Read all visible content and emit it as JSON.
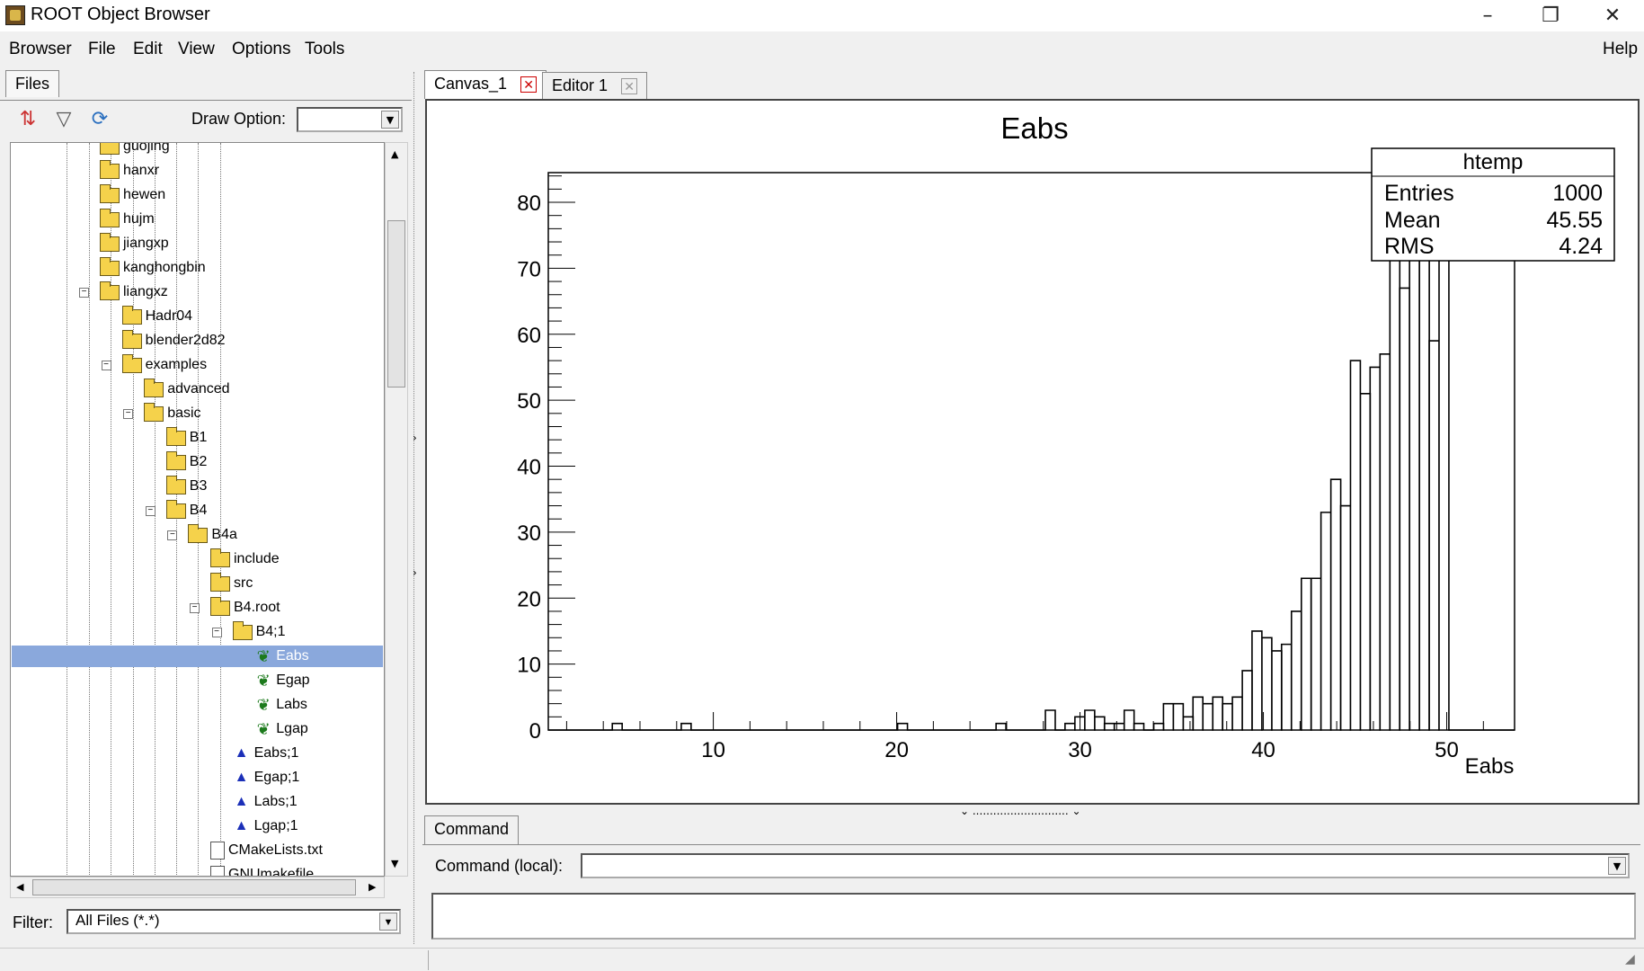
{
  "window": {
    "title": "ROOT Object Browser"
  },
  "menu": {
    "browser": "Browser",
    "file": "File",
    "edit": "Edit",
    "view": "View",
    "options": "Options",
    "tools": "Tools",
    "help": "Help"
  },
  "left": {
    "tab": "Files",
    "draw_option_label": "Draw Option:",
    "draw_option_value": "",
    "filter_label": "Filter:",
    "filter_value": "All Files (*.*)"
  },
  "tree": [
    {
      "label": "guojing",
      "icon": "folder"
    },
    {
      "label": "hanxr",
      "icon": "folder"
    },
    {
      "label": "hewen",
      "icon": "folder"
    },
    {
      "label": "hujm",
      "icon": "folder"
    },
    {
      "label": "jiangxp",
      "icon": "folder"
    },
    {
      "label": "kanghongbin",
      "icon": "folder"
    },
    {
      "label": "liangxz",
      "icon": "folder-open"
    },
    {
      "label": "Hadr04",
      "icon": "folder"
    },
    {
      "label": "blender2d82",
      "icon": "folder"
    },
    {
      "label": "examples",
      "icon": "folder-open"
    },
    {
      "label": "advanced",
      "icon": "folder"
    },
    {
      "label": "basic",
      "icon": "folder-open"
    },
    {
      "label": "B1",
      "icon": "folder"
    },
    {
      "label": "B2",
      "icon": "folder"
    },
    {
      "label": "B3",
      "icon": "folder"
    },
    {
      "label": "B4",
      "icon": "folder-open"
    },
    {
      "label": "B4a",
      "icon": "folder-open"
    },
    {
      "label": "include",
      "icon": "folder"
    },
    {
      "label": "src",
      "icon": "folder"
    },
    {
      "label": "B4.root",
      "icon": "root-file"
    },
    {
      "label": "B4;1",
      "icon": "tree"
    },
    {
      "label": "Eabs",
      "icon": "leaf",
      "selected": true
    },
    {
      "label": "Egap",
      "icon": "leaf"
    },
    {
      "label": "Labs",
      "icon": "leaf"
    },
    {
      "label": "Lgap",
      "icon": "leaf"
    },
    {
      "label": "Eabs;1",
      "icon": "histogram"
    },
    {
      "label": "Egap;1",
      "icon": "histogram"
    },
    {
      "label": "Labs;1",
      "icon": "histogram"
    },
    {
      "label": "Lgap;1",
      "icon": "histogram"
    },
    {
      "label": "CMakeLists.txt",
      "icon": "file"
    },
    {
      "label": "GNUmakefile",
      "icon": "file"
    }
  ],
  "tabs": {
    "canvas": "Canvas_1",
    "editor": "Editor 1"
  },
  "command": {
    "tab": "Command",
    "label": "Command (local):",
    "value": ""
  },
  "stats": {
    "title": "htemp",
    "rows": [
      {
        "k": "Entries",
        "v": "1000"
      },
      {
        "k": "Mean",
        "v": "45.55"
      },
      {
        "k": "RMS",
        "v": "4.24"
      }
    ]
  },
  "chart_data": {
    "type": "bar",
    "title": "Eabs",
    "xlabel": "Eabs",
    "ylabel": "",
    "xlim": [
      1,
      53.7
    ],
    "ylim": [
      0,
      84.5
    ],
    "xticks": [
      10,
      20,
      30,
      40,
      50
    ],
    "yticks": [
      0,
      10,
      20,
      30,
      40,
      50,
      60,
      70,
      80
    ],
    "bin_width": 0.537,
    "bins": [
      {
        "x": 4.76,
        "y": 1
      },
      {
        "x": 8.52,
        "y": 1
      },
      {
        "x": 20.32,
        "y": 1
      },
      {
        "x": 25.69,
        "y": 1
      },
      {
        "x": 28.38,
        "y": 3
      },
      {
        "x": 29.45,
        "y": 1
      },
      {
        "x": 29.99,
        "y": 2
      },
      {
        "x": 30.53,
        "y": 3
      },
      {
        "x": 31.07,
        "y": 2
      },
      {
        "x": 31.6,
        "y": 1
      },
      {
        "x": 32.14,
        "y": 1
      },
      {
        "x": 32.68,
        "y": 3
      },
      {
        "x": 33.21,
        "y": 1
      },
      {
        "x": 34.29,
        "y": 1
      },
      {
        "x": 34.82,
        "y": 4
      },
      {
        "x": 35.36,
        "y": 4
      },
      {
        "x": 35.9,
        "y": 2
      },
      {
        "x": 36.43,
        "y": 5
      },
      {
        "x": 36.97,
        "y": 4
      },
      {
        "x": 37.51,
        "y": 5
      },
      {
        "x": 38.04,
        "y": 4
      },
      {
        "x": 38.58,
        "y": 5
      },
      {
        "x": 39.12,
        "y": 9
      },
      {
        "x": 39.65,
        "y": 15
      },
      {
        "x": 40.19,
        "y": 14
      },
      {
        "x": 40.73,
        "y": 12
      },
      {
        "x": 41.26,
        "y": 13
      },
      {
        "x": 41.8,
        "y": 18
      },
      {
        "x": 42.34,
        "y": 23
      },
      {
        "x": 42.87,
        "y": 23
      },
      {
        "x": 43.41,
        "y": 33
      },
      {
        "x": 43.95,
        "y": 38
      },
      {
        "x": 44.48,
        "y": 34
      },
      {
        "x": 45.02,
        "y": 56
      },
      {
        "x": 45.56,
        "y": 51
      },
      {
        "x": 46.09,
        "y": 55
      },
      {
        "x": 46.63,
        "y": 57
      },
      {
        "x": 47.17,
        "y": 79
      },
      {
        "x": 47.7,
        "y": 67
      },
      {
        "x": 48.24,
        "y": 84
      },
      {
        "x": 48.78,
        "y": 82
      },
      {
        "x": 49.31,
        "y": 59
      },
      {
        "x": 49.85,
        "y": 84
      }
    ]
  }
}
